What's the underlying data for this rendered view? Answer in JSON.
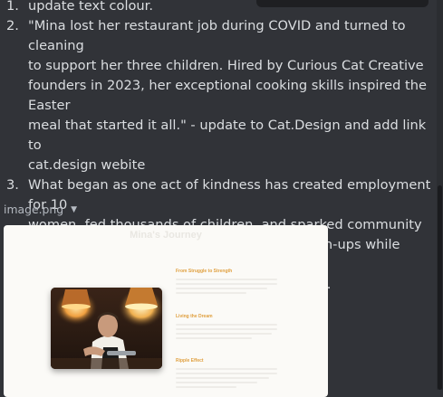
{
  "message": {
    "items": [
      {
        "number": "1.",
        "text": "update text colour."
      },
      {
        "number": "2.",
        "text": "\"Mina lost her restaurant job during COVID and turned to cleaning\nto support her three children. Hired by Curious Cat Creative\nfounders in 2023, her exceptional cooking skills inspired the Easter\nmeal that started it all.\" - update to Cat.Design and add link to\ncat.design webite"
      },
      {
        "number": "3.",
        "text": "What began as one act of kindness has created employment for 10\nwomen, fed thousands of children, and sparked community\ninitiatives like children organizing street clean-ups while waiting for\ntheir meals. - change to hundreds of children."
      }
    ]
  },
  "attachment": {
    "filename": "image.png",
    "icon": "chevron-down-icon"
  },
  "preview": {
    "title": "Mina's Journey",
    "subtitle": "",
    "sections": [
      {
        "heading": "From Struggle to Strength"
      },
      {
        "heading": "Living the Dream"
      },
      {
        "heading": "Ripple Effect"
      }
    ],
    "accent_color": "#e0a040",
    "photo": "chef-with-pendant-lamps-photo"
  },
  "colors": {
    "background": "#313338",
    "text": "#dbdee1",
    "muted": "#b5bac1"
  }
}
